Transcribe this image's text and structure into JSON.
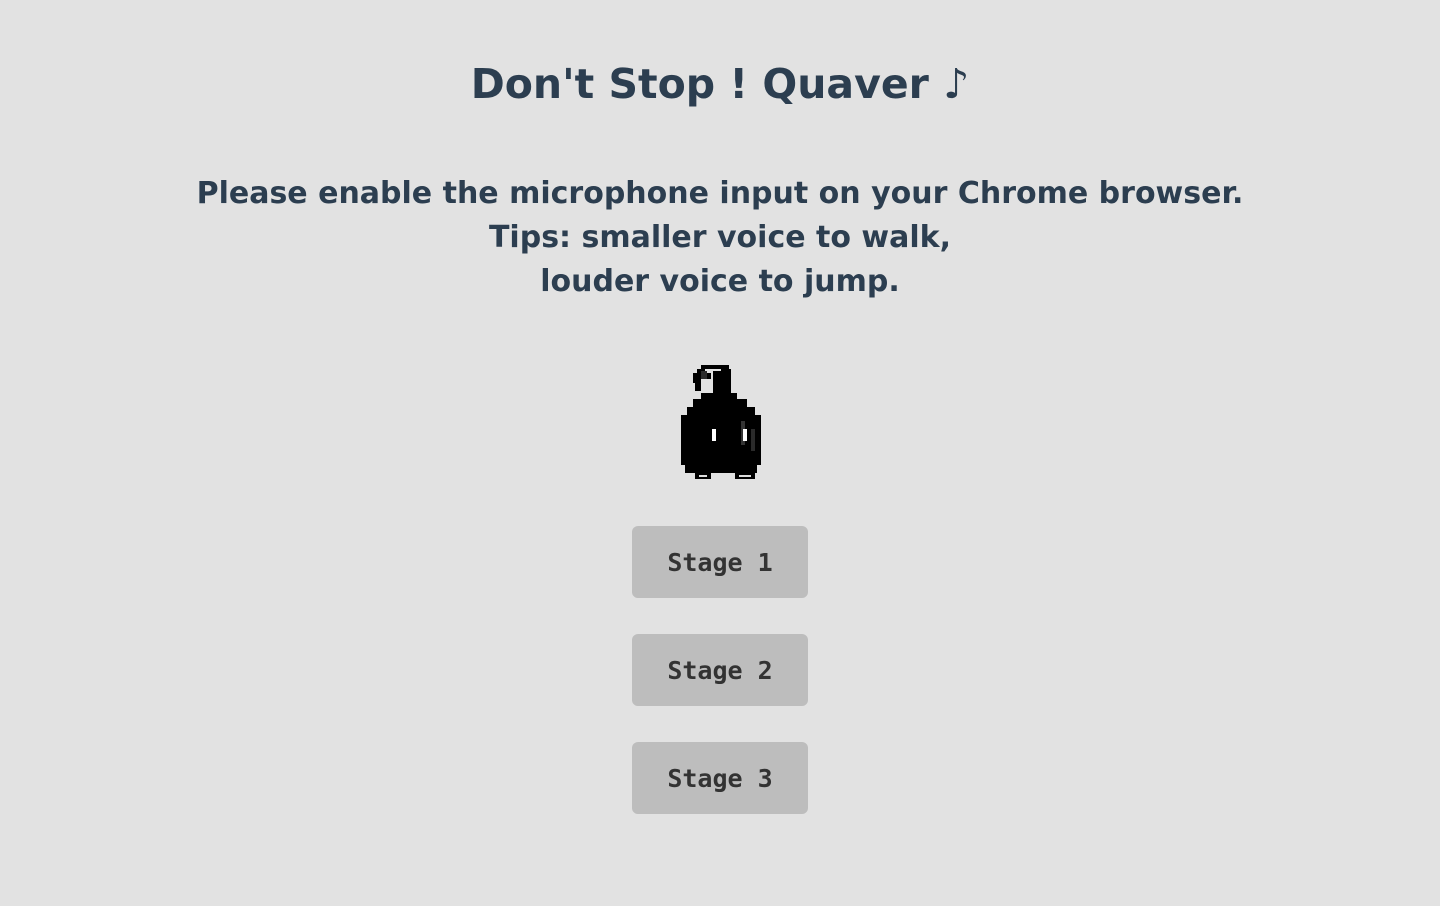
{
  "title": "Don't Stop ! Quaver ♪",
  "instructions": {
    "line1": "Please enable the microphone input on your Chrome browser.",
    "line2": "Tips: smaller voice to walk,",
    "line3": "louder voice to jump."
  },
  "character": {
    "icon": "quaver-note-character-icon",
    "body_color": "#000000",
    "eye_color": "#ffffff"
  },
  "stages": [
    {
      "label": "Stage 1"
    },
    {
      "label": "Stage 2"
    },
    {
      "label": "Stage 3"
    }
  ],
  "colors": {
    "background": "#e2e2e2",
    "text": "#2c3e50",
    "button_bg": "#bdbdbd",
    "button_text": "#333333"
  }
}
